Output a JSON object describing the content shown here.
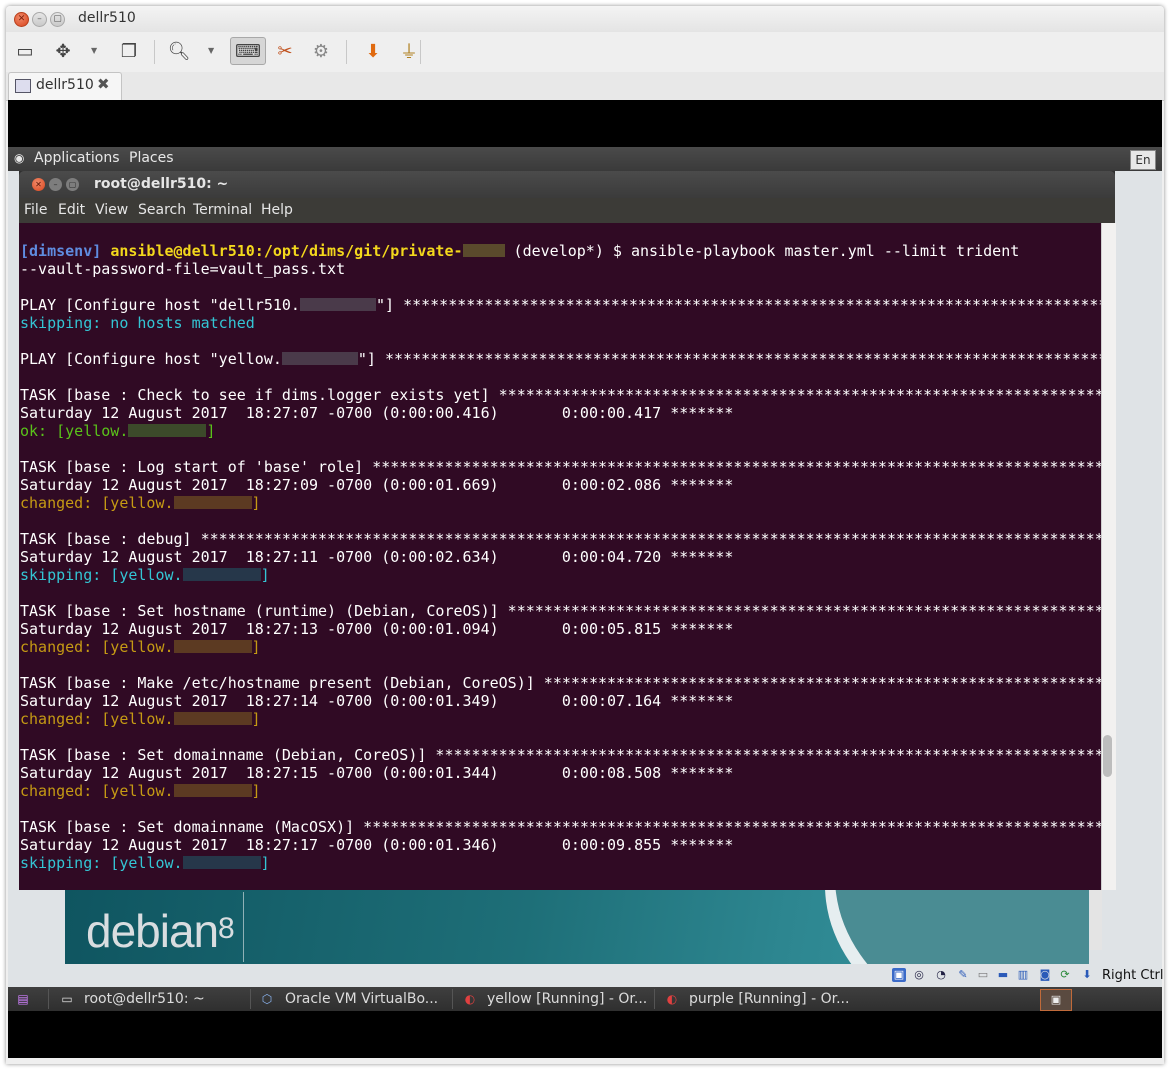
{
  "window": {
    "title": "dellr510"
  },
  "host_tab": {
    "label": "dellr510",
    "close_glyph": "✖"
  },
  "toolbar": {
    "icons": [
      "screen-icon",
      "fit-window-icon",
      "dropdown-arrow-icon",
      "windows-icon",
      "zoom-icon",
      "dropdown-arrow-icon",
      "keyboard-icon",
      "tools-icon",
      "settings-gears-icon",
      "usb-icon",
      "plug-icon"
    ]
  },
  "guest_panel": {
    "applications": "Applications",
    "places": "Places",
    "keyboard_layout": "En"
  },
  "terminal": {
    "title": "root@dellr510: ~",
    "menu": [
      "File",
      "Edit",
      "View",
      "Search",
      "Terminal",
      "Help"
    ],
    "prompt": {
      "env": "[dimsenv]",
      "userhost_path": "ansible@dellr510:/opt/dims/git/private-",
      "branch": "(develop*) $",
      "command": "ansible-playbook master.yml --limit trident",
      "command_cont": "--vault-password-file=vault_pass.txt"
    },
    "blocks": [
      {
        "header": "PLAY [Configure host \"dellr510.",
        "header_end": "\"] ",
        "result": "skipping: no hosts matched",
        "kind": "play"
      },
      {
        "header": "PLAY [Configure host \"yellow.",
        "header_end": "\"] ",
        "kind": "play2"
      },
      {
        "header": "TASK [base : Check to see if dims.logger exists yet] ",
        "timestamp": "Saturday 12 August 2017  18:27:07 -0700 (0:00:00.416)       0:00:00.417 *******",
        "result": "ok: [yellow.",
        "result_end": "]",
        "status": "ok"
      },
      {
        "header": "TASK [base : Log start of 'base' role] ",
        "timestamp": "Saturday 12 August 2017  18:27:09 -0700 (0:00:01.669)       0:00:02.086 *******",
        "result": "changed: [yellow.",
        "result_end": "]",
        "status": "changed"
      },
      {
        "header": "TASK [base : debug] ",
        "timestamp": "Saturday 12 August 2017  18:27:11 -0700 (0:00:02.634)       0:00:04.720 *******",
        "result": "skipping: [yellow.",
        "result_end": "]",
        "status": "skipping"
      },
      {
        "header": "TASK [base : Set hostname (runtime) (Debian, CoreOS)] ",
        "timestamp": "Saturday 12 August 2017  18:27:13 -0700 (0:00:01.094)       0:00:05.815 *******",
        "result": "changed: [yellow.",
        "result_end": "]",
        "status": "changed"
      },
      {
        "header": "TASK [base : Make /etc/hostname present (Debian, CoreOS)] ",
        "timestamp": "Saturday 12 August 2017  18:27:14 -0700 (0:00:01.349)       0:00:07.164 *******",
        "result": "changed: [yellow.",
        "result_end": "]",
        "status": "changed"
      },
      {
        "header": "TASK [base : Set domainname (Debian, CoreOS)] ",
        "timestamp": "Saturday 12 August 2017  18:27:15 -0700 (0:00:01.344)       0:00:08.508 *******",
        "result": "changed: [yellow.",
        "result_end": "]",
        "status": "changed"
      },
      {
        "header": "TASK [base : Set domainname (MacOSX)] ",
        "timestamp": "Saturday 12 August 2017  18:27:17 -0700 (0:00:01.346)       0:00:09.855 *******",
        "result": "skipping: [yellow.",
        "result_end": "]",
        "status": "skipping"
      }
    ],
    "stars": "**********************************************************************************************************",
    "colors": {
      "background": "#300a24",
      "ok": "#5ac21a",
      "changed": "#c59a14",
      "skipping": "#34c5d4",
      "env": "#5f8ce0",
      "userhost": "#f3d81c"
    }
  },
  "desktop": {
    "logo_word": "debian",
    "logo_version": "8"
  },
  "guest_tray": {
    "host_key": "Right Ctrl"
  },
  "guest_taskbar": {
    "items": [
      "root@dellr510: ~",
      "Oracle VM VirtualBo...",
      "yellow [Running] - Or...",
      "purple [Running] - Or..."
    ]
  }
}
